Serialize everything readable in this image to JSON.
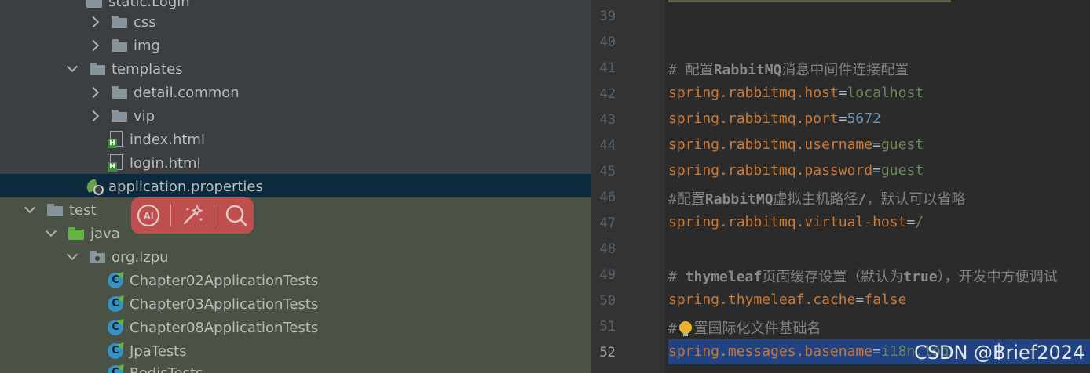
{
  "project_tree": {
    "items": [
      {
        "label": "static.Login",
        "type": "folder"
      },
      {
        "label": "css",
        "type": "folder",
        "expanded": false
      },
      {
        "label": "img",
        "type": "folder",
        "expanded": false
      },
      {
        "label": "templates",
        "type": "folder",
        "expanded": true
      },
      {
        "label": "detail.common",
        "type": "folder",
        "expanded": false
      },
      {
        "label": "vip",
        "type": "folder",
        "expanded": false
      },
      {
        "label": "index.html",
        "type": "html-file"
      },
      {
        "label": "login.html",
        "type": "html-file"
      },
      {
        "label": "application.properties",
        "type": "properties-file",
        "selected": true
      },
      {
        "label": "test",
        "type": "folder",
        "expanded": true
      },
      {
        "label": "java",
        "type": "source-folder",
        "expanded": true
      },
      {
        "label": "org.lzpu",
        "type": "package",
        "expanded": true
      },
      {
        "label": "Chapter02ApplicationTests",
        "type": "class"
      },
      {
        "label": "Chapter03ApplicationTests",
        "type": "class"
      },
      {
        "label": "Chapter08ApplicationTests",
        "type": "class"
      },
      {
        "label": "JpaTests",
        "type": "class"
      },
      {
        "label": "RedisTests",
        "type": "class"
      }
    ]
  },
  "floating_toolbar": {
    "buttons": [
      {
        "icon": "ai-icon",
        "label": "AI"
      },
      {
        "icon": "magic-wand-icon"
      },
      {
        "icon": "search-icon"
      }
    ]
  },
  "editor": {
    "lines": [
      {
        "n": "39",
        "segs": []
      },
      {
        "n": "40",
        "segs": []
      },
      {
        "n": "41",
        "segs": [
          {
            "t": "# 配置",
            "c": "c"
          },
          {
            "t": "RabbitMQ",
            "c": "cb"
          },
          {
            "t": "消息中间件连接配置",
            "c": "c"
          }
        ]
      },
      {
        "n": "42",
        "segs": [
          {
            "t": "spring.rabbitmq.host",
            "c": "k"
          },
          {
            "t": "=",
            "c": "eq"
          },
          {
            "t": "localhost",
            "c": "v"
          }
        ]
      },
      {
        "n": "43",
        "segs": [
          {
            "t": "spring.rabbitmq.port",
            "c": "k"
          },
          {
            "t": "=",
            "c": "eq"
          },
          {
            "t": "5672",
            "c": "n"
          }
        ]
      },
      {
        "n": "44",
        "segs": [
          {
            "t": "spring.rabbitmq.username",
            "c": "k"
          },
          {
            "t": "=",
            "c": "eq"
          },
          {
            "t": "guest",
            "c": "v"
          }
        ]
      },
      {
        "n": "45",
        "segs": [
          {
            "t": "spring.rabbitmq.password",
            "c": "k"
          },
          {
            "t": "=",
            "c": "eq"
          },
          {
            "t": "guest",
            "c": "v"
          }
        ]
      },
      {
        "n": "46",
        "segs": [
          {
            "t": "#配置",
            "c": "c"
          },
          {
            "t": "RabbitMQ",
            "c": "cb"
          },
          {
            "t": "虚拟主机路径",
            "c": "c"
          },
          {
            "t": "/",
            "c": "cb"
          },
          {
            "t": "，默认可以省略",
            "c": "c"
          }
        ]
      },
      {
        "n": "47",
        "segs": [
          {
            "t": "spring.rabbitmq.virtual-host",
            "c": "k"
          },
          {
            "t": "=",
            "c": "eq"
          },
          {
            "t": "/",
            "c": "v"
          }
        ]
      },
      {
        "n": "48",
        "segs": []
      },
      {
        "n": "49",
        "segs": [
          {
            "t": "# ",
            "c": "c"
          },
          {
            "t": "thymeleaf",
            "c": "cb"
          },
          {
            "t": "页面缓存设置（默认为",
            "c": "c"
          },
          {
            "t": "true",
            "c": "cb"
          },
          {
            "t": "），开发中方便调试",
            "c": "c"
          }
        ]
      },
      {
        "n": "50",
        "segs": [
          {
            "t": "spring.thymeleaf.cache",
            "c": "k"
          },
          {
            "t": "=",
            "c": "eq"
          },
          {
            "t": "false",
            "c": "k"
          }
        ]
      },
      {
        "n": "51",
        "segs": [
          {
            "t": "#  置国际化文件基础名",
            "c": "c"
          }
        ]
      },
      {
        "n": "52",
        "segs": [
          {
            "t": "spring.messages.basename",
            "c": "k"
          },
          {
            "t": "=",
            "c": "eq"
          },
          {
            "t": "i18n.log",
            "c": "v"
          }
        ],
        "current": true
      }
    ]
  },
  "watermark": {
    "text": "CSDN @Brief2024"
  }
}
